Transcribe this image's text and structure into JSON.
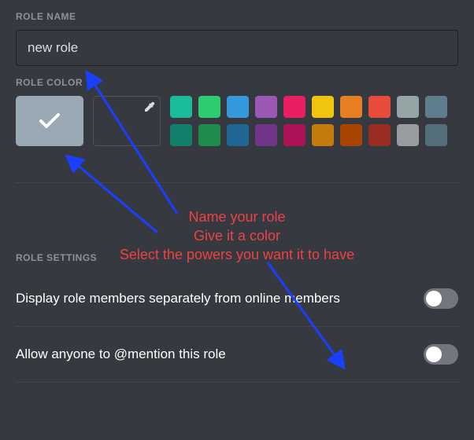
{
  "sections": {
    "role_name_label": "ROLE NAME",
    "role_color_label": "ROLE COLOR",
    "role_settings_label": "ROLE SETTINGS"
  },
  "role_name": {
    "value": "new role"
  },
  "palette": {
    "row1": [
      "#1abc9c",
      "#2ecc71",
      "#3498db",
      "#9b59b6",
      "#e91e63",
      "#f1c40f",
      "#e67e22",
      "#e74c3c",
      "#95a5a6",
      "#607d8b"
    ],
    "row2": [
      "#11806a",
      "#1f8b4c",
      "#206694",
      "#71368a",
      "#ad1457",
      "#c27c0e",
      "#a84300",
      "#992d22",
      "#979c9f",
      "#546e7a"
    ]
  },
  "settings": {
    "display_separately": {
      "label": "Display role members separately from online members",
      "enabled": false
    },
    "allow_mention": {
      "label": "Allow anyone to @mention this role",
      "enabled": false
    }
  },
  "annotations": {
    "line1": "Name your role",
    "line2": "Give it a color",
    "line3": "Select the powers you want it to have"
  }
}
